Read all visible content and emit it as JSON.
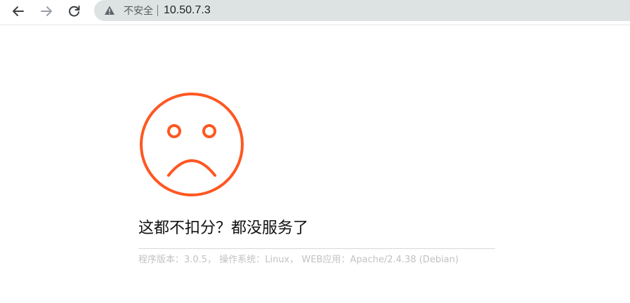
{
  "browser": {
    "security_label": "不安全",
    "url": "10.50.7.3",
    "icons": {
      "back": "arrow-left-icon",
      "forward": "arrow-right-icon",
      "reload": "reload-icon",
      "warning": "warning-triangle-icon"
    }
  },
  "error_page": {
    "face_icon": "sad-face-icon",
    "face_color": "#ff5722",
    "message": "这都不扣分？都没服务了",
    "footer": {
      "version": "程序版本：3.0.5，",
      "os": "操作系统：Linux，",
      "web": "WEB应用：Apache/2.4.38 (Debian)"
    }
  }
}
